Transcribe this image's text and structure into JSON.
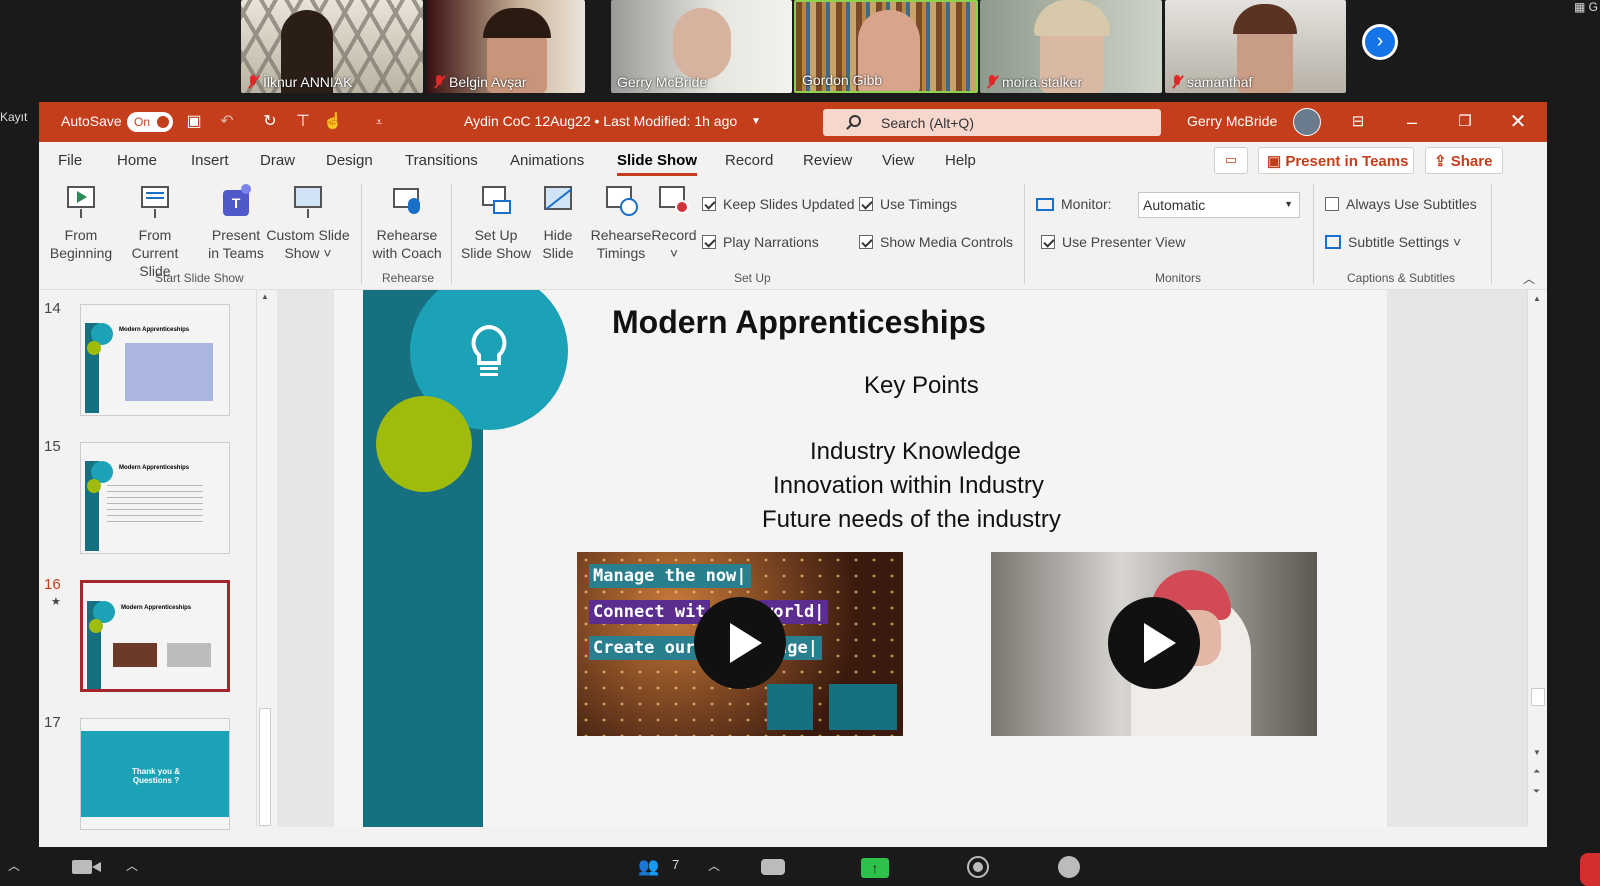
{
  "meeting": {
    "recording_label": "Kayıt",
    "participants": [
      {
        "name": "İlknur ANNIAK",
        "muted": true
      },
      {
        "name": "Belgin Avşar",
        "muted": true
      },
      {
        "name": "Gerry McBride",
        "muted": false
      },
      {
        "name": "Gordon Gibb",
        "muted": false
      },
      {
        "name": "moira.stalker",
        "muted": true
      },
      {
        "name": "samanthaf",
        "muted": true
      }
    ],
    "gallery_label": "G",
    "participants_count": "7"
  },
  "titlebar": {
    "autosave_label": "AutoSave",
    "autosave_state": "On",
    "document_title": "Aydin CoC  12Aug22 • Last Modified: 1h ago",
    "search_placeholder": "Search (Alt+Q)",
    "user_name": "Gerry McBride",
    "accent": "#c43e1c"
  },
  "tabs": [
    "File",
    "Home",
    "Insert",
    "Draw",
    "Design",
    "Transitions",
    "Animations",
    "Slide Show",
    "Record",
    "Review",
    "View",
    "Help"
  ],
  "active_tab": "Slide Show",
  "tab_actions": {
    "present_in_teams": "Present in Teams",
    "share": "Share"
  },
  "ribbon": {
    "start_group": "Start Slide Show",
    "from_beginning": [
      "From",
      "Beginning"
    ],
    "from_current": [
      "From",
      "Current Slide"
    ],
    "present_teams": [
      "Present",
      "in Teams"
    ],
    "custom_show": [
      "Custom Slide",
      "Show ˅"
    ],
    "rehearse_group": "Rehearse",
    "rehearse_coach": [
      "Rehearse",
      "with Coach"
    ],
    "setup_group": "Set Up",
    "setup_show": [
      "Set Up",
      "Slide Show"
    ],
    "hide_slide": [
      "Hide",
      "Slide"
    ],
    "rehearse_timings": [
      "Rehearse",
      "Timings"
    ],
    "record": [
      "Record",
      "˅"
    ],
    "keep_updated": "Keep Slides Updated",
    "use_timings": "Use Timings",
    "play_narrations": "Play Narrations",
    "show_media_controls": "Show Media Controls",
    "monitors_group": "Monitors",
    "monitor_label": "Monitor:",
    "monitor_value": "Automatic",
    "presenter_view": "Use Presenter View",
    "captions_group": "Captions & Subtitles",
    "always_subtitles": "Always Use Subtitles",
    "subtitle_settings": "Subtitle Settings ˅"
  },
  "thumbnails": [
    {
      "number": "14",
      "title": "Modern Apprenticeships"
    },
    {
      "number": "15",
      "title": "Modern Apprenticeships"
    },
    {
      "number": "16",
      "title": "Modern Apprenticeships"
    },
    {
      "number": "17",
      "title": "Thank you & Questions ?"
    }
  ],
  "selected_slide": "16",
  "slide": {
    "title": "Modern Apprenticeships",
    "subtitle": "Key Points",
    "points": [
      "Industry Knowledge",
      "Innovation within Industry",
      "Future needs of the industry"
    ],
    "video1_lines": [
      "Manage the now|",
      "Connect wit",
      "world|",
      "Create our",
      "nge|"
    ],
    "teal": "#17707f",
    "cyan": "#1ba2b6",
    "lime": "#9fbc0c"
  }
}
